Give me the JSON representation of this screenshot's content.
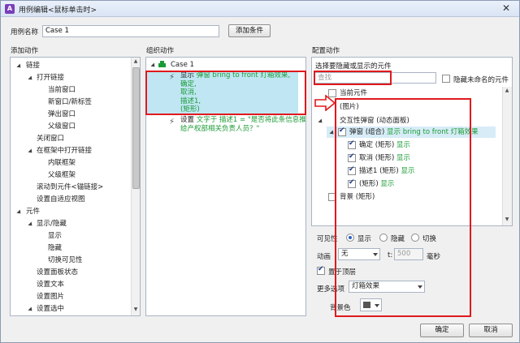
{
  "window": {
    "title": "用例编辑<鼠标单击时>"
  },
  "case_name": {
    "label": "用例名称",
    "value": "Case 1",
    "add_condition": "添加条件"
  },
  "left_panel": {
    "heading": "添加动作",
    "items": [
      "链接",
      "打开链接",
      "当前窗口",
      "新窗口/新标签",
      "弹出窗口",
      "父级窗口",
      "关闭窗口",
      "在框架中打开链接",
      "内联框架",
      "父级框架",
      "滚动到元件<锚链接>",
      "设置自适应视图",
      "元件",
      "显示/隐藏",
      "显示",
      "隐藏",
      "切换可见性",
      "设置面板状态",
      "设置文本",
      "设置图片",
      "设置选中"
    ]
  },
  "middle_panel": {
    "heading": "组织动作",
    "case_label": "Case 1",
    "action1": {
      "verb": "显示",
      "lines": [
        "弹窗 bring to front 灯箱效果,",
        "确定,",
        "取消,",
        "描述1,",
        "(矩形)"
      ]
    },
    "action2": {
      "verb": "设置",
      "lines": [
        "文字于 描述1 = \"是否将此条信息推送",
        "给产权部相关负责人员？\""
      ]
    }
  },
  "right_panel": {
    "heading": "配置动作",
    "subheading": "选择要隐藏或显示的元件",
    "search_placeholder": "查找",
    "hide_unnamed": "隐藏未命名的元件",
    "tree": {
      "current": "当前元件",
      "image": "(图片)",
      "group_header": "交互性弹窗 (动态面板)",
      "popup_name": "弹窗 (组合)",
      "popup_action": "显示 bring to front 灯箱效果",
      "children": [
        {
          "name": "确定 (矩形)",
          "action": "显示"
        },
        {
          "name": "取消 (矩形)",
          "action": "显示"
        },
        {
          "name": "描述1 (矩形)",
          "action": "显示"
        },
        {
          "name": "(矩形)",
          "action": "显示"
        }
      ],
      "background": "背景 (矩形)"
    },
    "visibility": {
      "label": "可见性",
      "options": [
        "显示",
        "隐藏",
        "切换"
      ]
    },
    "animation": {
      "label": "动画",
      "value": "无",
      "t_label": "t:",
      "t_value": "500",
      "unit": "毫秒"
    },
    "bring_to_front": "置于顶层",
    "more_options": {
      "label": "更多选项",
      "value": "灯箱效果"
    },
    "background_color": {
      "label": "背景色"
    }
  },
  "footer": {
    "ok": "确定",
    "cancel": "取消"
  },
  "colors": {
    "accent_red": "#e0191d",
    "selection": "#bfe6f2",
    "green_text": "#1a9b35"
  }
}
